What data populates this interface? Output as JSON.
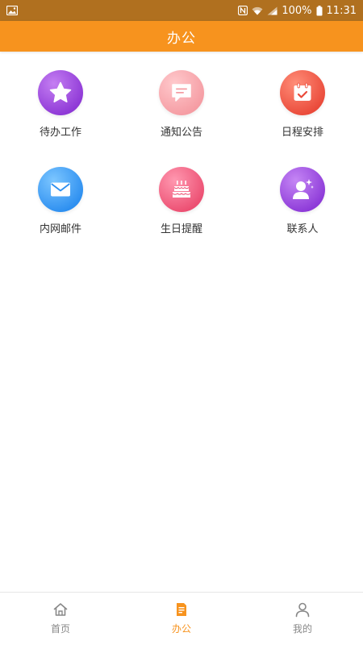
{
  "status_bar": {
    "battery": "100%",
    "time": "11:31"
  },
  "header": {
    "title": "办公"
  },
  "grid": [
    {
      "label": "待办工作",
      "icon": "star-icon",
      "color": "#9b45e0"
    },
    {
      "label": "通知公告",
      "icon": "message-icon",
      "color": "#f7a3a8"
    },
    {
      "label": "日程安排",
      "icon": "calendar-check-icon",
      "color": "#ef5a43"
    },
    {
      "label": "内网邮件",
      "icon": "mail-icon",
      "color": "#3a96f2"
    },
    {
      "label": "生日提醒",
      "icon": "birthday-cake-icon",
      "color": "#ee5879"
    },
    {
      "label": "联系人",
      "icon": "contact-person-icon",
      "color": "#9642dc"
    }
  ],
  "bottom_nav": {
    "active_index": 1,
    "accent": "#f7931e",
    "items": [
      {
        "label": "首页",
        "icon": "home-icon"
      },
      {
        "label": "办公",
        "icon": "document-icon"
      },
      {
        "label": "我的",
        "icon": "user-icon"
      }
    ]
  }
}
